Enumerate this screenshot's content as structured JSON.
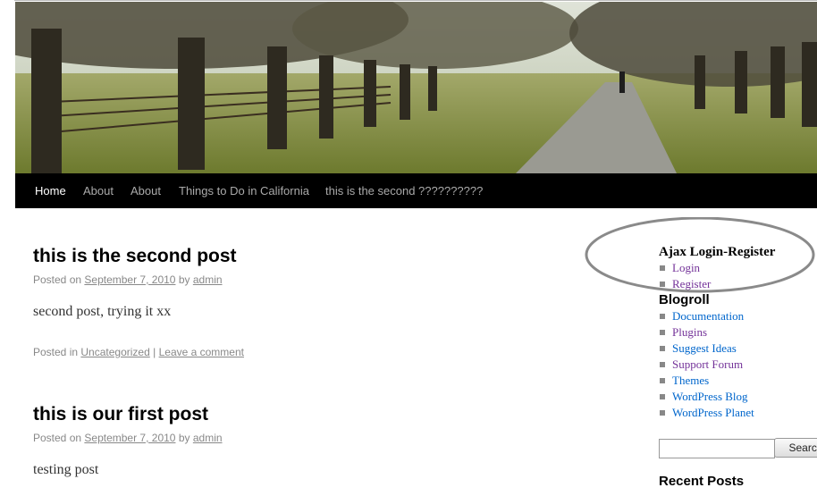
{
  "nav": {
    "items": [
      {
        "label": "Home",
        "active": true
      },
      {
        "label": "About"
      },
      {
        "label": "About"
      },
      {
        "label": "Things to Do in California"
      },
      {
        "label": "this is the second ??????????"
      }
    ]
  },
  "posts": [
    {
      "title": "this is the second post",
      "posted_on": "Posted on",
      "date": "September 7, 2010",
      "by": "by",
      "author": "admin",
      "content": "second post, trying it xx",
      "posted_in": "Posted in",
      "category": "Uncategorized",
      "separator": "|",
      "comment_link": "Leave a comment"
    },
    {
      "title": "this is our first post",
      "posted_on": "Posted on",
      "date": "September 7, 2010",
      "by": "by",
      "author": "admin",
      "content": "testing post"
    }
  ],
  "sidebar": {
    "ajax_widget": {
      "title": "Ajax Login-Register",
      "links": [
        "Login",
        "Register"
      ]
    },
    "blogroll": {
      "title": "Blogroll",
      "links": [
        "Documentation",
        "Plugins",
        "Suggest Ideas",
        "Support Forum",
        "Themes",
        "WordPress Blog",
        "WordPress Planet"
      ]
    },
    "search": {
      "placeholder": "",
      "button": "Search"
    },
    "recent_posts": {
      "title": "Recent Posts"
    }
  },
  "colors": {
    "link": "#0066cc",
    "visited": "#743399",
    "nav_bg": "#000000"
  }
}
